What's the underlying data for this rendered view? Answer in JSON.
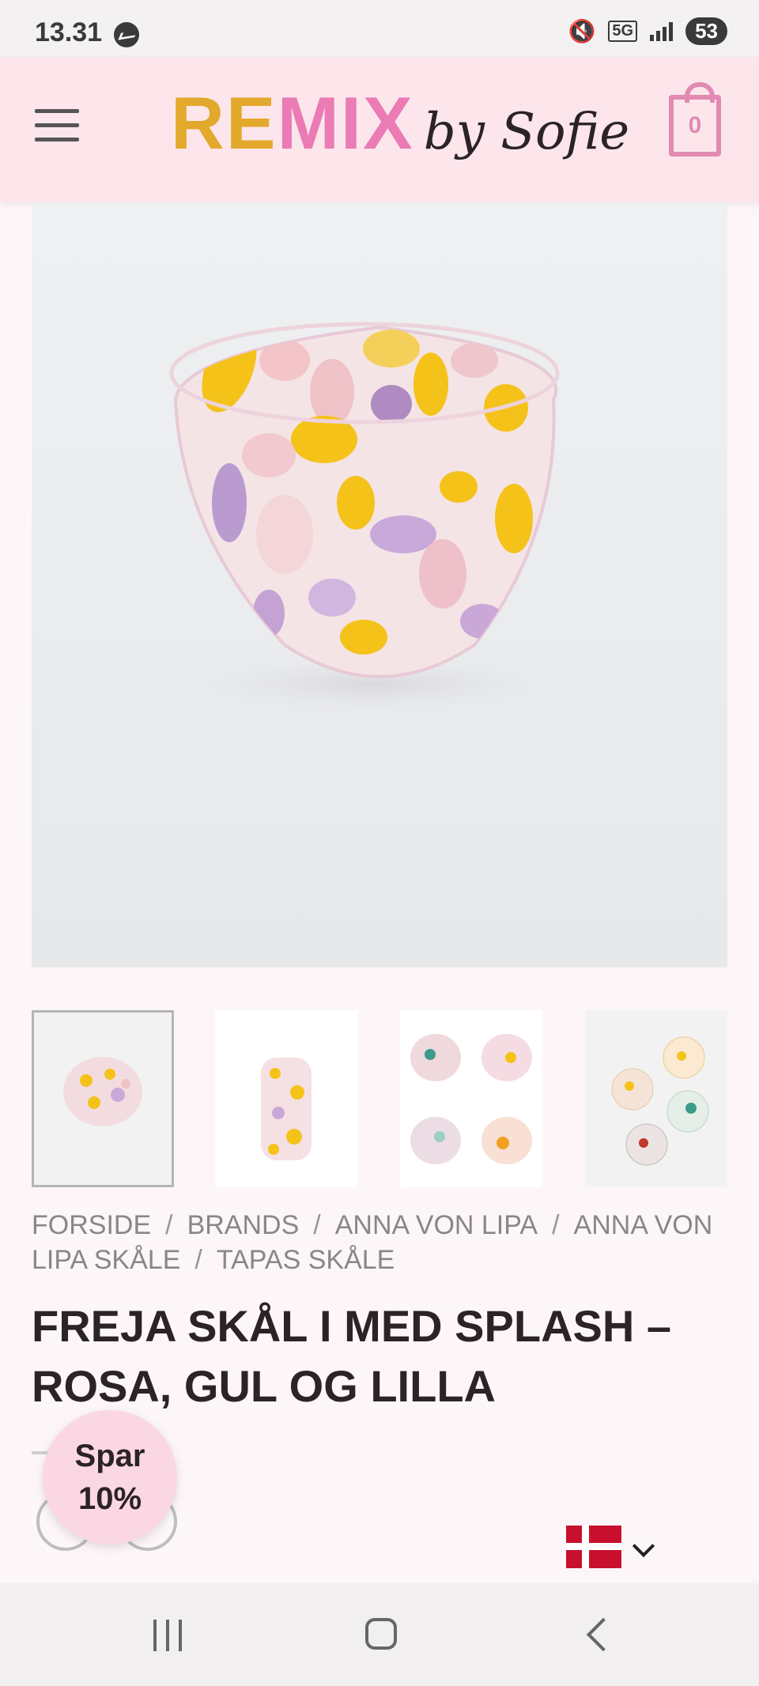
{
  "status_bar": {
    "time": "13.31",
    "network": "5G",
    "battery": "53"
  },
  "header": {
    "logo": {
      "part1": "RE",
      "part2": "MIX",
      "part3": "by Sofie"
    },
    "cart_count": "0",
    "menu_icon": "hamburger-menu-icon",
    "cart_icon": "shopping-bag-icon"
  },
  "gallery": {
    "main_image_alt": "bowl with splash pattern",
    "thumbnails": [
      {
        "alt": "bowl"
      },
      {
        "alt": "stacked bowls"
      },
      {
        "alt": "four bowls grid"
      },
      {
        "alt": "bowls top view"
      }
    ]
  },
  "breadcrumb": {
    "items": [
      "FORSIDE",
      "BRANDS",
      "ANNA VON LIPA",
      "ANNA VON LIPA SKÅLE",
      "TAPAS SKÅLE"
    ],
    "separator": "/"
  },
  "product": {
    "title": "FREJA SKÅL I MED SPLASH – ROSA, GUL OG LILLA"
  },
  "promo": {
    "line1": "Spar",
    "line2": "10%"
  },
  "language": {
    "flag": "denmark-flag-icon"
  },
  "colors": {
    "header_bg": "#fce6ec",
    "logo_yellow": "#e3a92c",
    "logo_pink": "#ea7bb4",
    "cart_pink": "#e28ab2",
    "promo_bg": "#fbd7e3"
  }
}
